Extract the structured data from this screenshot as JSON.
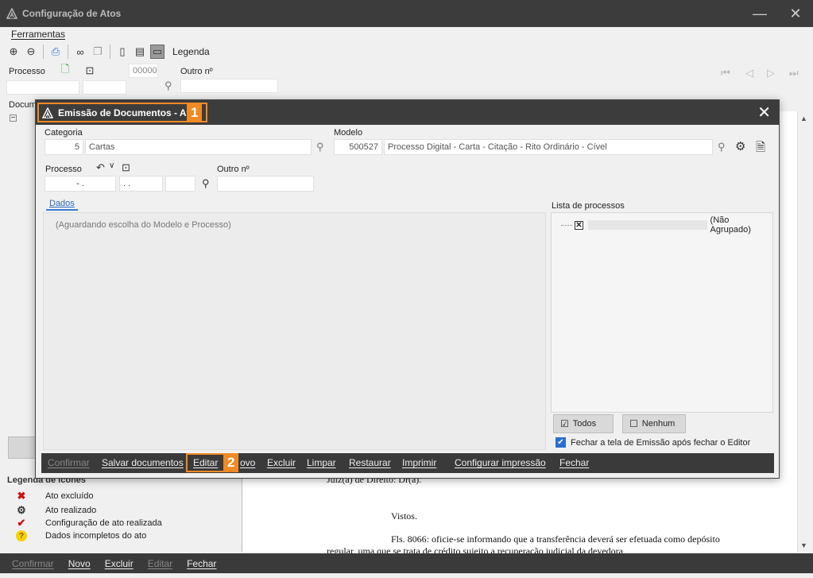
{
  "background_window": {
    "title": "Configuração de Atos",
    "controls": {
      "minimize": "—",
      "close": "✕"
    },
    "menu": {
      "tools_label": "Ferramentas"
    },
    "toolbar": {
      "icons": [
        "zoom-in-icon",
        "zoom-out-icon",
        "print-icon",
        "binoculars-icon",
        "copy-icon",
        "page-single-icon",
        "page-list-icon",
        "page-wide-icon"
      ],
      "legend_label": "Legenda"
    },
    "process": {
      "label": "Processo",
      "number_value": "00000",
      "other_label": "Outro nº"
    },
    "doc_label": "Docum",
    "nav": {
      "first": "⏮",
      "prev": "◁",
      "next": "▷",
      "last": "⏭"
    },
    "document_text": {
      "line1": "Juiz(a) de Direito: Dr(a).",
      "line2": "Vistos.",
      "line3": "Fls. 8066: oficie-se informando que a transferência deverá ser efetuada como depósito",
      "line4": "regular, uma que se trata de crédito sujeito a recuperação judicial da devedora"
    },
    "legend": {
      "title": "Legenda de ícones",
      "items": [
        {
          "icon": "red-x-icon",
          "label": "Ato excluído",
          "color": "#cc1111"
        },
        {
          "icon": "gear-done-icon",
          "label": "Ato realizado",
          "color": "#333333"
        },
        {
          "icon": "red-check-icon",
          "label": "Configuração de ato realizada",
          "color": "#cc1111"
        },
        {
          "icon": "question-icon",
          "label": "Dados incompletos do ato",
          "color": "#e8b600"
        }
      ]
    },
    "bottom_bar": {
      "confirm": "Confirmar",
      "new": "Novo",
      "delete": "Excluir",
      "edit": "Editar",
      "close": "Fechar"
    }
  },
  "modal": {
    "title": "Emissão de Documentos - Atos",
    "badge1": "1",
    "close": "✕",
    "categoria": {
      "label": "Categoria",
      "code": "5",
      "name": "Cartas"
    },
    "modelo": {
      "label": "Modelo",
      "code": "500527",
      "name": "Processo Digital - Carta - Citação - Rito Ordinário - Cível"
    },
    "processo": {
      "label": "Processo",
      "part1": "-   .",
      "part2": ".   .",
      "other_label": "Outro nº"
    },
    "tab_dados": "Dados",
    "dados_message": "(Aguardando escolha do Modelo e Processo)",
    "lista": {
      "label": "Lista de processos",
      "item_suffix": "(Não Agrupado)"
    },
    "buttons": {
      "all": "Todos",
      "none": "Nenhum"
    },
    "close_after_editor": "Fechar a tela de Emissão após fechar o Editor",
    "bar": {
      "confirm": "Confirmar",
      "save": "Salvar documentos",
      "edit": "Editar",
      "new_partial": "ovo",
      "delete": "Excluir",
      "clear": "Limpar",
      "restore": "Restaurar",
      "print": "Imprimir",
      "config_print": "Configurar impressão",
      "close": "Fechar"
    },
    "badge2": "2",
    "accent_color": "#f08a24"
  }
}
